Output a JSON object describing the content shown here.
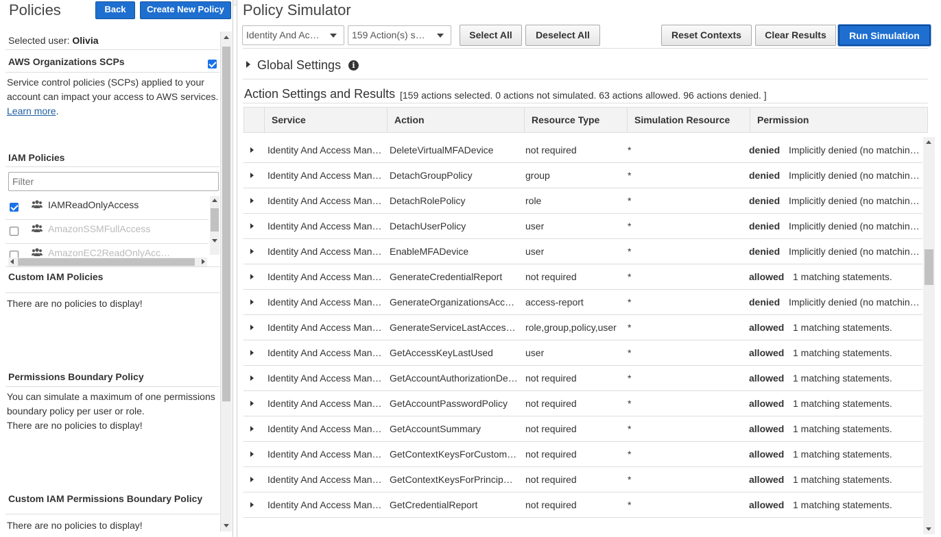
{
  "left": {
    "title": "Policies",
    "back_label": "Back",
    "create_label": "Create New Policy",
    "selected_user_label": "Selected user:",
    "selected_user": "Olivia",
    "scp": {
      "heading": "AWS Organizations SCPs",
      "desc": "Service control policies (SCPs) applied to your account can impact your access to AWS services.",
      "learn_more": "Learn more",
      "after_link": "."
    },
    "iam": {
      "heading": "IAM Policies",
      "filter_placeholder": "Filter",
      "items": [
        {
          "name": "IAMReadOnlyAccess",
          "checked": true
        },
        {
          "name": "AmazonSSMFullAccess",
          "checked": false
        },
        {
          "name": "AmazonEC2ReadOnlyAcc…",
          "checked": false
        }
      ]
    },
    "custom_iam": {
      "heading": "Custom IAM Policies",
      "empty": "There are no policies to display!"
    },
    "boundary": {
      "heading": "Permissions Boundary Policy",
      "desc": "You can simulate a maximum of one permissions boundary policy per user or role.",
      "empty": "There are no policies to display!"
    },
    "custom_boundary": {
      "heading": "Custom IAM Permissions Boundary Policy",
      "empty": "There are no policies to display!"
    }
  },
  "main": {
    "title": "Policy Simulator",
    "service_dropdown": "Identity And Ac…",
    "actions_dropdown": "159 Action(s) s…",
    "select_all": "Select All",
    "deselect_all": "Deselect All",
    "reset_contexts": "Reset Contexts",
    "clear_results": "Clear Results",
    "run_simulation": "Run Simulation",
    "global_settings": "Global Settings",
    "action_settings": "Action Settings and Results",
    "summary": "[159 actions selected. 0 actions not simulated. 63 actions allowed. 96 actions denied. ]",
    "columns": [
      "Service",
      "Action",
      "Resource Type",
      "Simulation Resource",
      "Permission"
    ],
    "rows": [
      {
        "service": "Identity And Access Man…",
        "action": "DeleteVirtualMFADevice",
        "resource_type": "not required",
        "sim_resource": "*",
        "permission": "denied",
        "note": "Implicitly denied (no matchin…"
      },
      {
        "service": "Identity And Access Man…",
        "action": "DetachGroupPolicy",
        "resource_type": "group",
        "sim_resource": "*",
        "permission": "denied",
        "note": "Implicitly denied (no matchin…"
      },
      {
        "service": "Identity And Access Man…",
        "action": "DetachRolePolicy",
        "resource_type": "role",
        "sim_resource": "*",
        "permission": "denied",
        "note": "Implicitly denied (no matchin…"
      },
      {
        "service": "Identity And Access Man…",
        "action": "DetachUserPolicy",
        "resource_type": "user",
        "sim_resource": "*",
        "permission": "denied",
        "note": "Implicitly denied (no matchin…"
      },
      {
        "service": "Identity And Access Man…",
        "action": "EnableMFADevice",
        "resource_type": "user",
        "sim_resource": "*",
        "permission": "denied",
        "note": "Implicitly denied (no matchin…"
      },
      {
        "service": "Identity And Access Man…",
        "action": "GenerateCredentialReport",
        "resource_type": "not required",
        "sim_resource": "*",
        "permission": "allowed",
        "note": "1 matching statements."
      },
      {
        "service": "Identity And Access Man…",
        "action": "GenerateOrganizationsAcc…",
        "resource_type": "access-report",
        "sim_resource": "*",
        "permission": "denied",
        "note": "Implicitly denied (no matchin…"
      },
      {
        "service": "Identity And Access Man…",
        "action": "GenerateServiceLastAcces…",
        "resource_type": "role,group,policy,user",
        "sim_resource": "*",
        "permission": "allowed",
        "note": "1 matching statements."
      },
      {
        "service": "Identity And Access Man…",
        "action": "GetAccessKeyLastUsed",
        "resource_type": "user",
        "sim_resource": "*",
        "permission": "allowed",
        "note": "1 matching statements."
      },
      {
        "service": "Identity And Access Man…",
        "action": "GetAccountAuthorizationDe…",
        "resource_type": "not required",
        "sim_resource": "*",
        "permission": "allowed",
        "note": "1 matching statements."
      },
      {
        "service": "Identity And Access Man…",
        "action": "GetAccountPasswordPolicy",
        "resource_type": "not required",
        "sim_resource": "*",
        "permission": "allowed",
        "note": "1 matching statements."
      },
      {
        "service": "Identity And Access Man…",
        "action": "GetAccountSummary",
        "resource_type": "not required",
        "sim_resource": "*",
        "permission": "allowed",
        "note": "1 matching statements."
      },
      {
        "service": "Identity And Access Man…",
        "action": "GetContextKeysForCustom…",
        "resource_type": "not required",
        "sim_resource": "*",
        "permission": "allowed",
        "note": "1 matching statements."
      },
      {
        "service": "Identity And Access Man…",
        "action": "GetContextKeysForPrincipa…",
        "resource_type": "not required",
        "sim_resource": "*",
        "permission": "allowed",
        "note": "1 matching statements."
      },
      {
        "service": "Identity And Access Man…",
        "action": "GetCredentialReport",
        "resource_type": "not required",
        "sim_resource": "*",
        "permission": "allowed",
        "note": "1 matching statements."
      }
    ]
  }
}
